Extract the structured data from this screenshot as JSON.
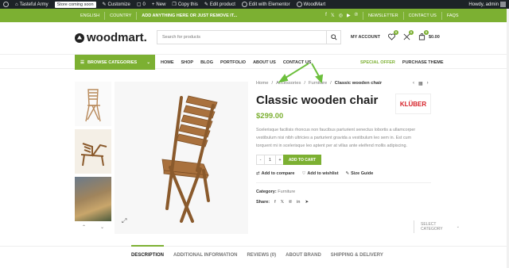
{
  "admin_bar": {
    "site_name": "Tasteful Army",
    "coming_soon": "Store coming soon",
    "customize": "Customize",
    "comments_count": "0",
    "new": "New",
    "copy_this": "Copy this",
    "edit_product": "Edit product",
    "edit_elementor": "Edit with Elementor",
    "woodmart": "WoodMart",
    "howdy": "Howdy, admin"
  },
  "topbar": {
    "language": "ENGLISH",
    "country": "COUNTRY",
    "promo": "ADD ANYTHING HERE OR JUST REMOVE IT...",
    "newsletter": "NEWSLETTER",
    "contact": "CONTACT US",
    "faqs": "FAQS"
  },
  "header": {
    "logo": "woodmart.",
    "search_placeholder": "Search for products",
    "select_category": "SELECT CATEGORY",
    "my_account": "MY ACCOUNT",
    "wishlist_count": "0",
    "compare_count": "0",
    "cart_count": "0",
    "cart_total": "$0.00"
  },
  "nav": {
    "browse": "BROWSE CATEGORIES",
    "items": [
      "HOME",
      "SHOP",
      "BLOG",
      "PORTFOLIO",
      "ABOUT US",
      "CONTACT US"
    ],
    "special": "SPECIAL OFFER",
    "purchase": "PURCHASE THEME"
  },
  "breadcrumb": {
    "home": "Home",
    "accessories": "Accessories",
    "furniture": "Furniture",
    "current": "Classic wooden chair"
  },
  "product": {
    "title": "Classic wooden chair",
    "brand": "KLÜBER",
    "price": "$299.00",
    "description": "Scelerisque facilisis rhoncus non faucibus parturient senectus lobortis a ullamcorper vestibulum nisi nibh ultricies a parturient gravida a vestibulum leo sem in. Est cum torquent mi in scelerisque leo aptent per at villas ante eleifend mollis adipiscing.",
    "qty": "1",
    "add_to_cart": "ADD TO CART",
    "compare": "Add to compare",
    "wishlist": "Add to wishlist",
    "size_guide": "Size Guide",
    "category_label": "Category:",
    "category_value": "Furniture",
    "share_label": "Share:"
  },
  "tabs": [
    "DESCRIPTION",
    "ADDITIONAL INFORMATION",
    "REVIEWS (0)",
    "ABOUT BRAND",
    "SHIPPING & DELIVERY"
  ],
  "colors": {
    "accent": "#7cb032",
    "admin_bar": "#1d2327",
    "annotation": "#6cbf3c"
  }
}
